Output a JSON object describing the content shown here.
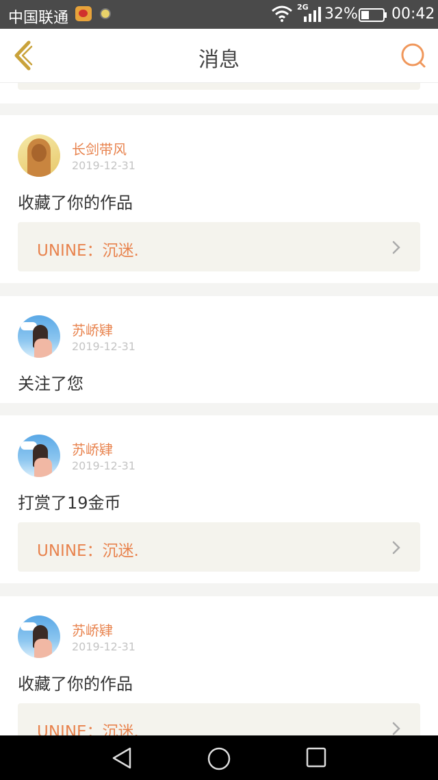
{
  "status_bar": {
    "carrier": "中国联通",
    "network_type": "2G",
    "battery": "32%",
    "time": "00:42"
  },
  "header": {
    "title": "消息"
  },
  "notifications": [
    {
      "user": "长剑带风",
      "avatar": "avatar-blonde-girl",
      "date": "2019-12-31",
      "action": "收藏了你的作品",
      "work": "UNINE：沉迷."
    },
    {
      "user": "苏峤肄",
      "avatar": "avatar-sky-girl",
      "date": "2019-12-31",
      "action": "关注了您"
    },
    {
      "user": "苏峤肄",
      "avatar": "avatar-sky-girl",
      "date": "2019-12-31",
      "action": "打赏了19金币",
      "work": "UNINE：沉迷."
    },
    {
      "user": "苏峤肄",
      "avatar": "avatar-sky-girl",
      "date": "2019-12-31",
      "action": "收藏了你的作品",
      "work": "UNINE：沉迷."
    }
  ],
  "colors": {
    "accent": "#e8834e",
    "back_icon": "#c9a23a",
    "link_bg": "#f4f3ed"
  }
}
